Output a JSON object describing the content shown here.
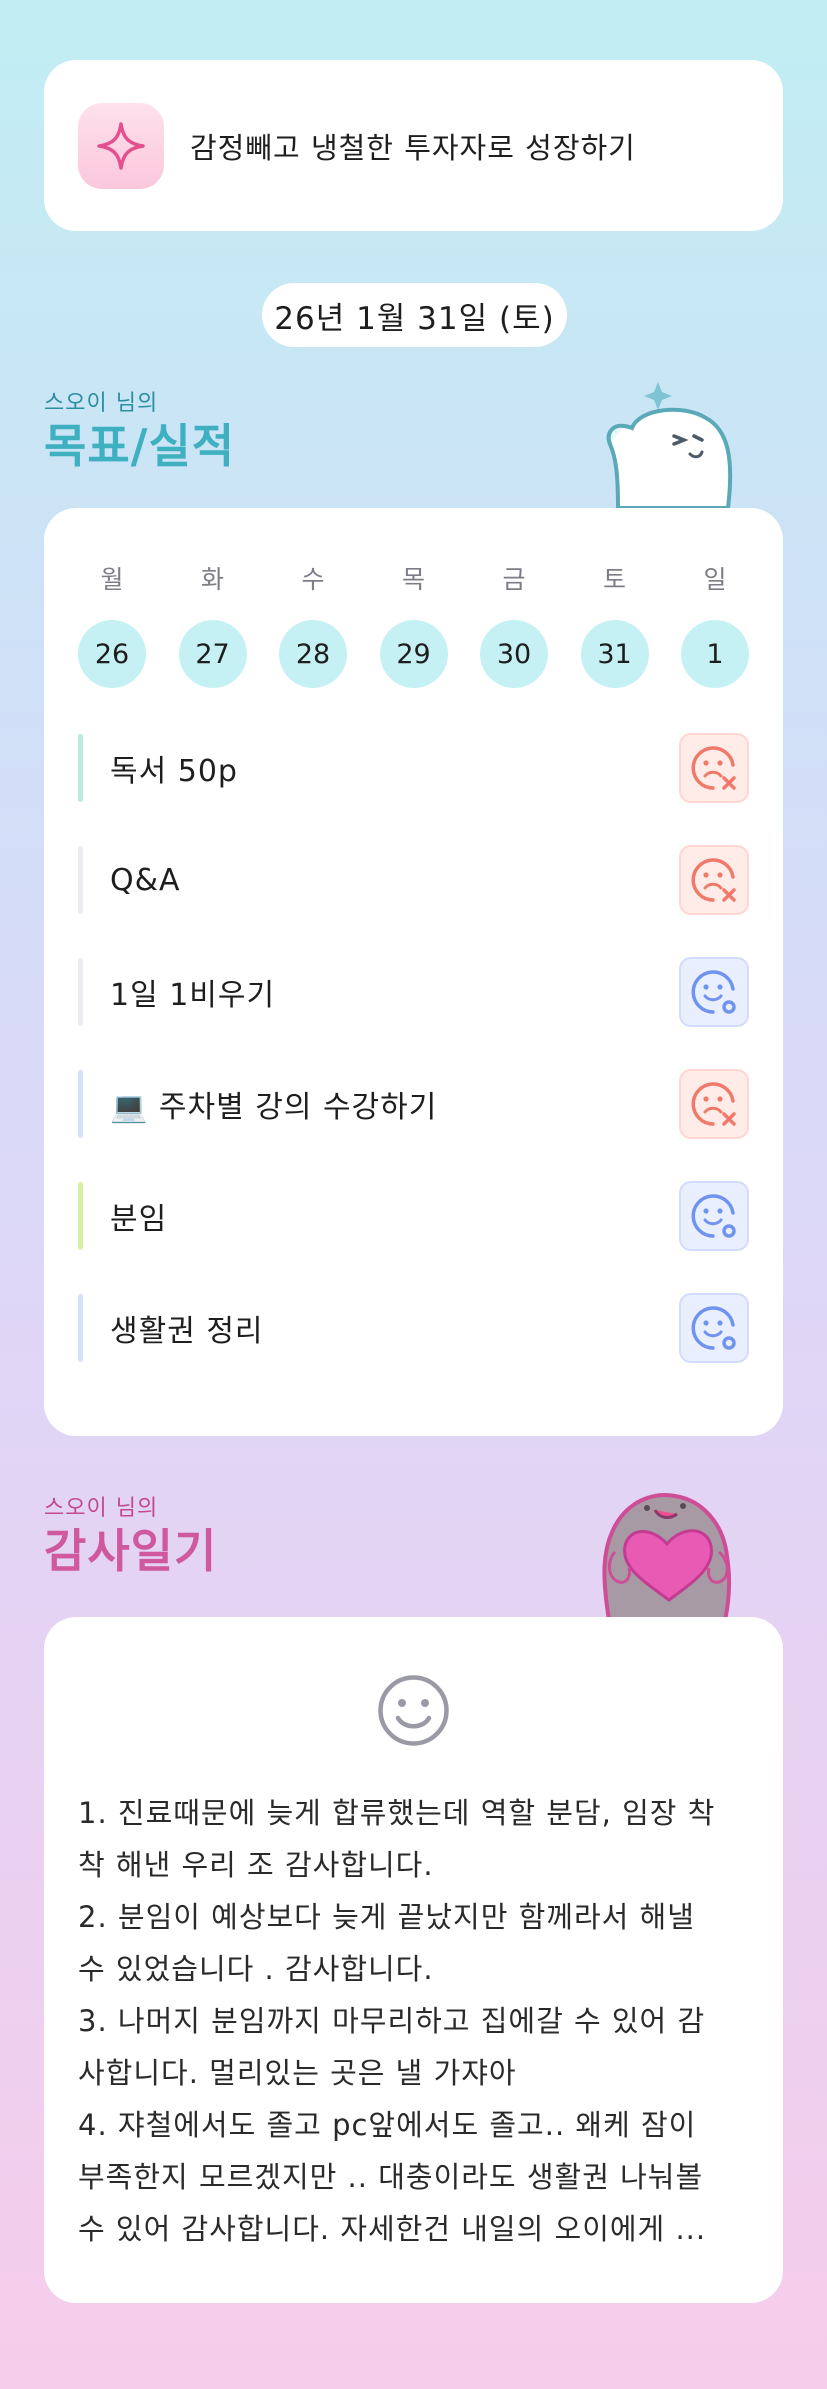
{
  "goal": {
    "text": "감정빼고 냉철한 투자자로 성장하기",
    "icon": "sparkle-icon"
  },
  "date": "26년 1월 31일 (토)",
  "goals_section": {
    "subtitle": "스오이 님의",
    "title": "목표/실적"
  },
  "week": {
    "weekdays": [
      "월",
      "화",
      "수",
      "목",
      "금",
      "토",
      "일"
    ],
    "dates": [
      "26",
      "27",
      "28",
      "29",
      "30",
      "31",
      "1"
    ]
  },
  "goals": [
    {
      "label": "독서 50p",
      "status": "fail",
      "bar_color": "#b9ecdf"
    },
    {
      "label": "Q&A",
      "status": "fail",
      "bar_color": "#ececf0"
    },
    {
      "label": "1일 1비우기",
      "status": "ok",
      "bar_color": "#ececf0"
    },
    {
      "label": "💻 주차별 강의 수강하기",
      "status": "fail",
      "bar_color": "#d4e2f5"
    },
    {
      "label": "분임",
      "status": "ok",
      "bar_color": "#d8efa8"
    },
    {
      "label": "생활권 정리",
      "status": "ok",
      "bar_color": "#d4e2f5"
    }
  ],
  "gratitude_section": {
    "subtitle": "스오이 님의",
    "title": "감사일기"
  },
  "gratitude": {
    "lines": [
      "1. 진료때문에 늦게 합류했는데 역할 분담, 임장 착",
      "착 해낸 우리 조 감사합니다.",
      "2. 분임이 예상보다 늦게 끝났지만 함께라서 해낼",
      "수 있었습니다 . 감사합니다.",
      "3. 나머지 분임까지 마무리하고 집에갈 수 있어 감",
      "사합니다. 멀리있는 곳은 낼 가쟈아",
      "4. 쟈철에서도 졸고 pc앞에서도 졸고.. 왜케 잠이",
      "부족한지 모르겠지만 .. 대충이라도 생활권 나눠볼",
      "수 있어 감사합니다. 자세한건 내일의 오이에게 ..."
    ]
  },
  "colors": {
    "accent_cyan": "#3fb0c0",
    "accent_pink": "#d0589e",
    "fail_red": "#f07a6a",
    "ok_blue": "#6f93ef"
  }
}
